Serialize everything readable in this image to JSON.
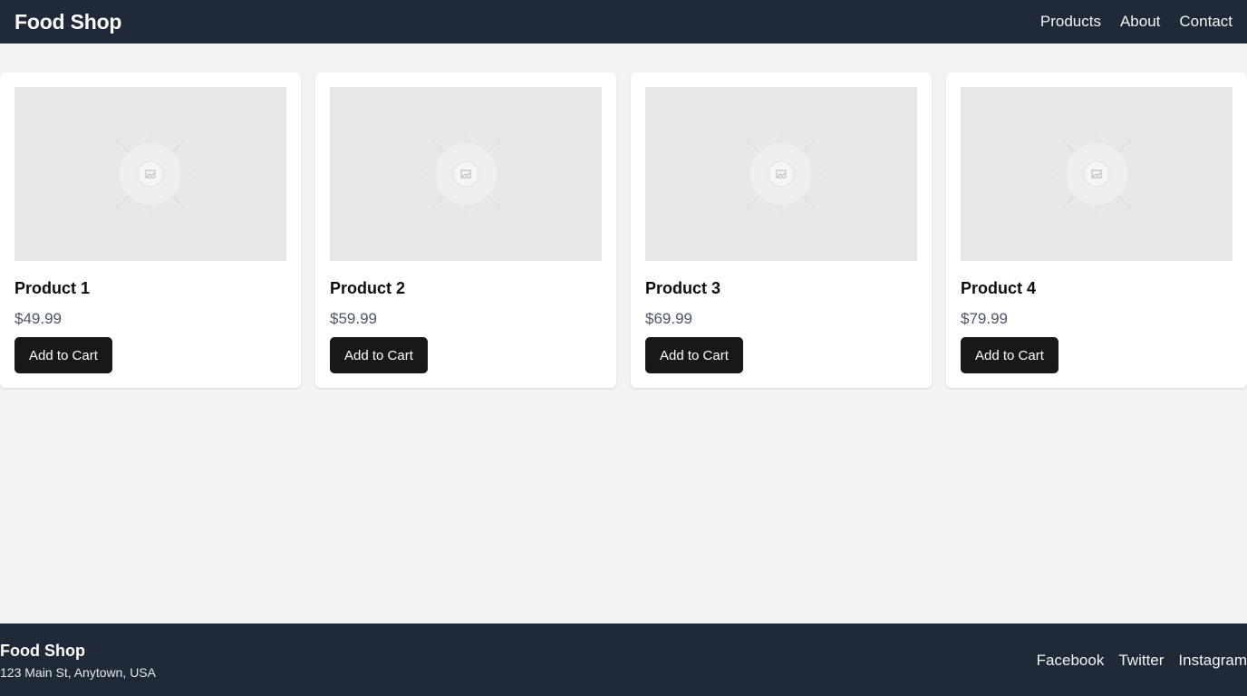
{
  "header": {
    "brand": "Food Shop",
    "nav": [
      "Products",
      "About",
      "Contact"
    ]
  },
  "products": [
    {
      "name": "Product 1",
      "price": "$49.99",
      "button": "Add to Cart"
    },
    {
      "name": "Product 2",
      "price": "$59.99",
      "button": "Add to Cart"
    },
    {
      "name": "Product 3",
      "price": "$69.99",
      "button": "Add to Cart"
    },
    {
      "name": "Product 4",
      "price": "$79.99",
      "button": "Add to Cart"
    }
  ],
  "footer": {
    "brand": "Food Shop",
    "address": "123 Main St, Anytown, USA",
    "links": [
      "Facebook",
      "Twitter",
      "Instagram"
    ]
  },
  "colors": {
    "header_bg": "#1f2937",
    "page_bg": "#f2f3f5",
    "button_bg": "#18181b",
    "price_text": "#4b5563"
  },
  "icons": {
    "product_image": "image-placeholder-icon"
  }
}
